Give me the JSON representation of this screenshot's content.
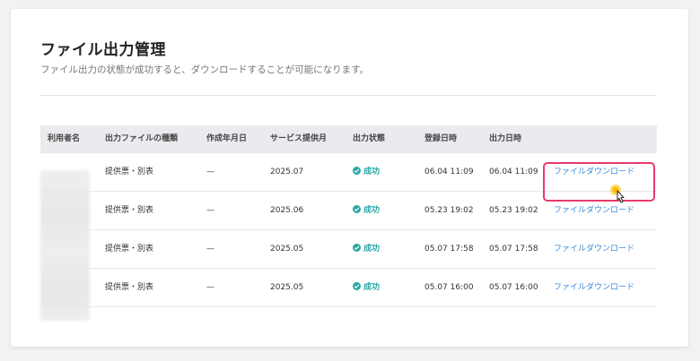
{
  "page": {
    "title": "ファイル出力管理",
    "description": "ファイル出力の状態が成功すると、ダウンロードすることが可能になります。"
  },
  "table": {
    "headers": [
      "利用者名",
      "出力ファイルの種類",
      "作成年月日",
      "サービス提供月",
      "出力状態",
      "登録日時",
      "出力日時",
      ""
    ],
    "rows": [
      {
        "user": "",
        "file_type": "提供票・別表",
        "created": "—",
        "service_month": "2025.07",
        "status": "成功",
        "registered": "06.04 11:09",
        "output": "06.04 11:09",
        "action": "ファイルダウンロード"
      },
      {
        "user": "",
        "file_type": "提供票・別表",
        "created": "—",
        "service_month": "2025.06",
        "status": "成功",
        "registered": "05.23 19:02",
        "output": "05.23 19:02",
        "action": "ファイルダウンロード"
      },
      {
        "user": "",
        "file_type": "提供票・別表",
        "created": "—",
        "service_month": "2025.05",
        "status": "成功",
        "registered": "05.07 17:58",
        "output": "05.07 17:58",
        "action": "ファイルダウンロード"
      },
      {
        "user": "",
        "file_type": "提供票・別表",
        "created": "—",
        "service_month": "2025.05",
        "status": "成功",
        "registered": "05.07 16:00",
        "output": "05.07 16:00",
        "action": "ファイルダウンロード"
      }
    ]
  },
  "colors": {
    "accent_link": "#3a8be0",
    "status_success": "#2aa6a6",
    "highlight": "#e83a6b"
  },
  "icons": {
    "status": "check-circle-icon",
    "cursor": "hand-pointer-icon"
  }
}
